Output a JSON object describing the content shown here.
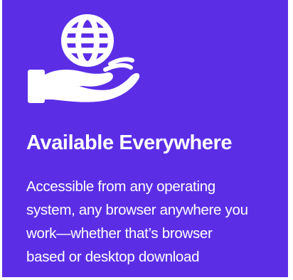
{
  "card": {
    "icon": "globe-in-hand-icon",
    "title": "Available Everywhere",
    "description_lines": [
      "Accessible from any operating",
      "system, any browser anywhere you",
      "work—whether that’s browser",
      "based or desktop download"
    ],
    "colors": {
      "background": "#5b2ee6",
      "foreground": "#ffffff"
    }
  }
}
